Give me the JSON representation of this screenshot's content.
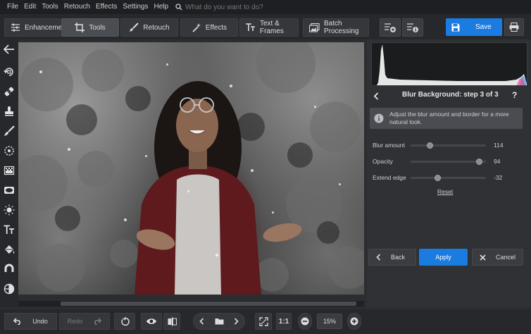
{
  "menu": {
    "items": [
      "File",
      "Edit",
      "Tools",
      "Retouch",
      "Effects",
      "Settings",
      "Help"
    ],
    "search_placeholder": "What do you want to do?"
  },
  "tabs": {
    "enhancement": "Enhancement",
    "tools": "Tools",
    "retouch": "Retouch",
    "effects": "Effects",
    "text_frames": "Text & Frames",
    "batch": "Batch Processing"
  },
  "save_label": "Save",
  "panel": {
    "title": "Blur Background: step 3 of 3",
    "help": "?",
    "info": "Adjust the blur amount and border for a more natural look.",
    "sliders": [
      {
        "label": "Blur amount",
        "value": "114",
        "level": 0.26
      },
      {
        "label": "Opacity",
        "value": "94",
        "level": 0.94
      },
      {
        "label": "Extend edge",
        "value": "-32",
        "level": 0.36
      }
    ],
    "reset": "Reset",
    "back": "Back",
    "apply": "Apply",
    "cancel": "Cancel"
  },
  "bottom": {
    "undo": "Undo",
    "redo": "Redo",
    "ratio": "1:1",
    "zoom": "15%"
  },
  "colors": {
    "accent": "#1a7be0",
    "background": "#2b2d30"
  }
}
